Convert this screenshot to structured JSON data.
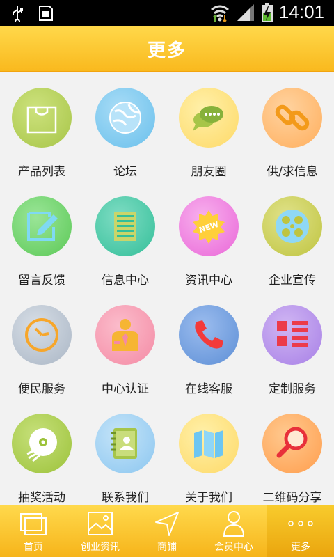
{
  "status_bar": {
    "time": "14:01",
    "icons": [
      "usb-icon",
      "sim-icon",
      "wifi-icon",
      "signal-icon",
      "battery-charging-icon"
    ]
  },
  "header": {
    "title": "更多"
  },
  "grid": {
    "items": [
      {
        "label": "产品列表",
        "icon": "shopping-bag-icon",
        "color": "#b3cf5a"
      },
      {
        "label": "论坛",
        "icon": "globe-icon",
        "color": "#7cc9ef"
      },
      {
        "label": "朋友圈",
        "icon": "chat-bubbles-icon",
        "color": "#ffe27a"
      },
      {
        "label": "供/求信息",
        "icon": "chain-link-icon",
        "color": "#ffc077"
      },
      {
        "label": "留言反馈",
        "icon": "edit-note-icon",
        "color": "#74d66f"
      },
      {
        "label": "信息中心",
        "icon": "notepad-icon",
        "color": "#45c9a8"
      },
      {
        "label": "资讯中心",
        "icon": "new-badge-icon",
        "color": "#f07fe1"
      },
      {
        "label": "企业宣传",
        "icon": "film-reel-icon",
        "color": "#cdd05a"
      },
      {
        "label": "便民服务",
        "icon": "clock-icon",
        "color": "#b9c4d1"
      },
      {
        "label": "中心认证",
        "icon": "person-badge-icon",
        "color": "#f79ab1"
      },
      {
        "label": "在线客服",
        "icon": "phone-icon",
        "color": "#6e9bdc"
      },
      {
        "label": "定制服务",
        "icon": "grid-list-icon",
        "color": "#b792ea"
      },
      {
        "label": "抽奖活动",
        "icon": "disc-icon",
        "color": "#a9cc46"
      },
      {
        "label": "联系我们",
        "icon": "address-book-icon",
        "color": "#9ccef3"
      },
      {
        "label": "关于我们",
        "icon": "map-icon",
        "color": "#ffe27a"
      },
      {
        "label": "二维码分享",
        "icon": "magnifier-icon",
        "color": "#ffa55c"
      }
    ]
  },
  "bottom_nav": {
    "items": [
      {
        "label": "首页",
        "icon": "pages-icon"
      },
      {
        "label": "创业资讯",
        "icon": "picture-icon"
      },
      {
        "label": "商铺",
        "icon": "navigation-arrow-icon"
      },
      {
        "label": "会员中心",
        "icon": "person-icon"
      },
      {
        "label": "更多",
        "icon": "more-dots-icon"
      }
    ],
    "active_index": 4
  },
  "colors": {
    "accent": "#f9b91e",
    "header_top": "#ffd84a",
    "status_bar": "#000000",
    "background": "#f2f2f2"
  }
}
